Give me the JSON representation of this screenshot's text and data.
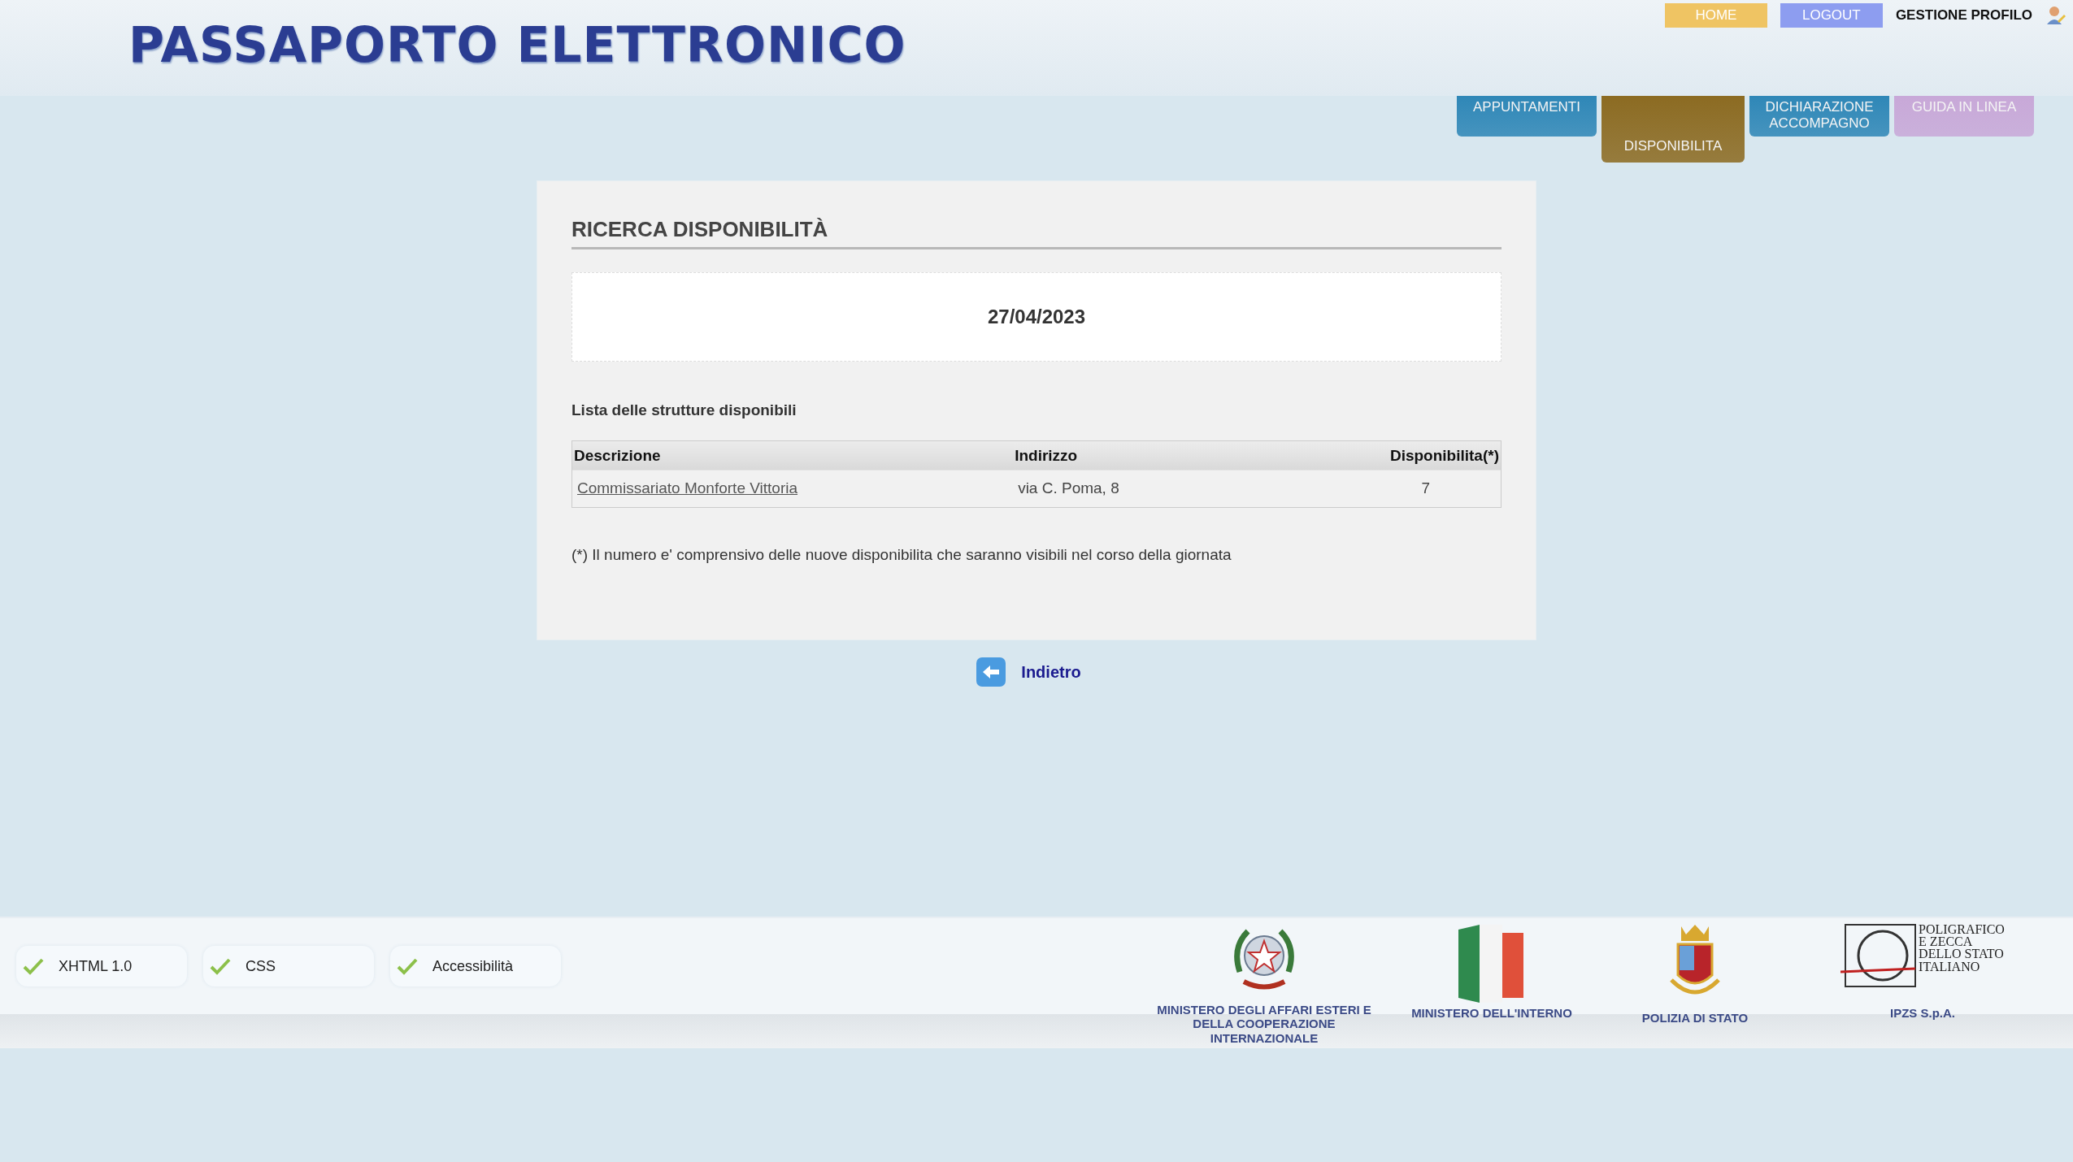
{
  "header": {
    "title": "PASSAPORTO ELETTRONICO"
  },
  "top_links": [
    {
      "label": "HOME",
      "color": "#efc463"
    },
    {
      "label": "LOGOUT",
      "color": "#8d9df0"
    }
  ],
  "profile": {
    "label": "GESTIONE PROFILO"
  },
  "tabs": [
    {
      "label": "APPUNTAMENTI",
      "selected": false,
      "color": "#2f87b7"
    },
    {
      "label": "DISPONIBILITA",
      "selected": true,
      "color": "#8c6b22"
    },
    {
      "label": "DICHIARAZIONE ACCOMPAGNO",
      "selected": false,
      "color": "#2f87b7"
    },
    {
      "label": "GUIDA IN LINEA",
      "selected": false,
      "color": "#c8a8d8"
    }
  ],
  "panel": {
    "title": "RICERCA DISPONIBILITÀ",
    "date": "27/04/2023",
    "list_title": "Lista delle strutture disponibili",
    "table": {
      "columns": [
        "Descrizione",
        "Indirizzo",
        "Disponibilita(*)"
      ],
      "rows": [
        [
          "Commissariato Monforte Vittoria",
          "via C. Poma, 8",
          "7"
        ]
      ]
    },
    "note": "(*) Il numero e' comprensivo delle nuove disponibilita che saranno visibili nel corso della giornata"
  },
  "back": {
    "label": "Indietro"
  },
  "footer": {
    "badges": [
      "XHTML 1.0",
      "CSS",
      "Accessibilità"
    ],
    "logos": [
      {
        "kind": "emblem",
        "caption": "MINISTERO DEGLI AFFARI ESTERI E\nDELLA COOPERAZIONE INTERNAZIONALE"
      },
      {
        "kind": "flag",
        "caption": "MINISTERO DELL'INTERNO"
      },
      {
        "kind": "crest",
        "caption": "POLIZIA DI STATO"
      },
      {
        "kind": "mint",
        "logo_text": "POLIGRAFICO\nE ZECCA\nDELLO STATO\nITALIANO",
        "caption": "IPZS S.p.A."
      }
    ]
  }
}
